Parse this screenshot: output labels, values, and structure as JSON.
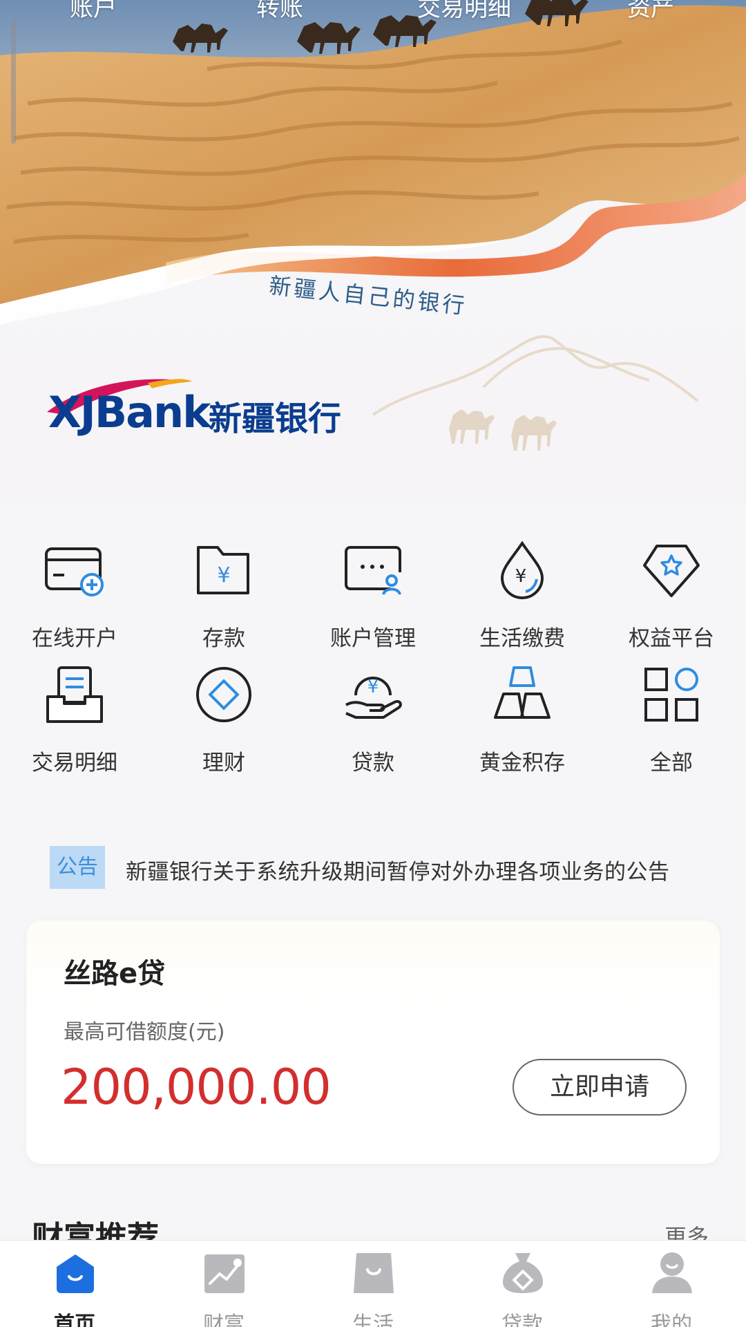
{
  "top_tabs": [
    "账户",
    "转账",
    "交易明细",
    "资产"
  ],
  "banner": {
    "slogan": "新疆人自己的银行",
    "logo_en": "XJBank",
    "logo_cn": "新疆银行"
  },
  "quick_grid": [
    {
      "label": "在线开户",
      "icon": "open-account-icon"
    },
    {
      "label": "存款",
      "icon": "deposit-folder-icon"
    },
    {
      "label": "账户管理",
      "icon": "account-management-icon"
    },
    {
      "label": "生活缴费",
      "icon": "utility-payment-icon"
    },
    {
      "label": "权益平台",
      "icon": "benefits-platform-icon"
    },
    {
      "label": "交易明细",
      "icon": "transaction-details-icon"
    },
    {
      "label": "理财",
      "icon": "wealth-management-icon"
    },
    {
      "label": "贷款",
      "icon": "loan-icon"
    },
    {
      "label": "黄金积存",
      "icon": "gold-savings-icon"
    },
    {
      "label": "全部",
      "icon": "all-services-icon"
    }
  ],
  "notice": {
    "badge": "公告",
    "text": "新疆银行关于系统升级期间暂停对外办理各项业务的公告"
  },
  "loan_card": {
    "title": "丝路e贷",
    "subtitle": "最高可借额度(元)",
    "amount": "200,000.00",
    "apply_label": "立即申请"
  },
  "wealth": {
    "title": "财富推荐",
    "more": "更多"
  },
  "bottom_nav": [
    {
      "label": "首页",
      "icon": "home-icon",
      "active": true
    },
    {
      "label": "财富",
      "icon": "wealth-chart-icon",
      "active": false
    },
    {
      "label": "生活",
      "icon": "shopping-bag-icon",
      "active": false
    },
    {
      "label": "贷款",
      "icon": "money-bag-icon",
      "active": false
    },
    {
      "label": "我的",
      "icon": "profile-icon",
      "active": false
    }
  ],
  "colors": {
    "accent_blue": "#1d6fe0",
    "amount_red": "#d32e2e",
    "notice_bg": "#bcd9f5",
    "notice_text": "#3b8fd8",
    "icon_blue": "#2f8ce0"
  }
}
